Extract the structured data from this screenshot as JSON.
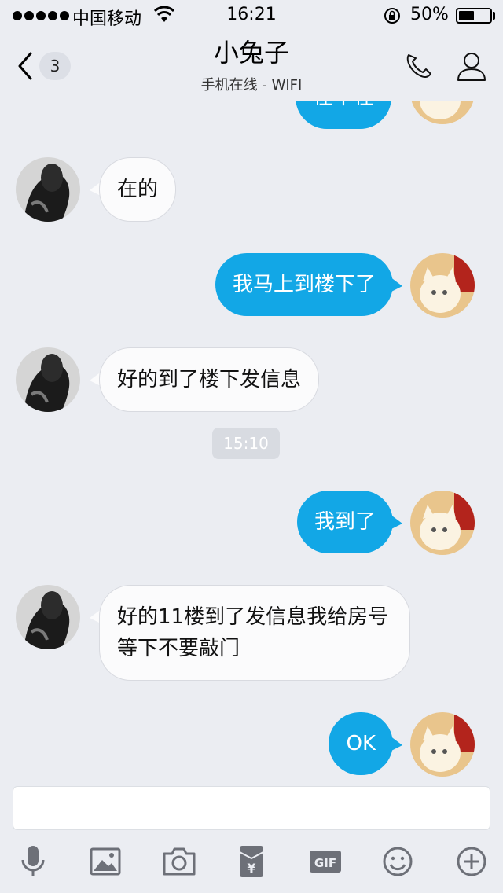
{
  "status_bar": {
    "carrier": "中国移动",
    "time": "16:21",
    "battery_percent": "50%",
    "battery_level": 0.5
  },
  "nav": {
    "back_badge": "3",
    "title": "小兔子",
    "subtitle": "手机在线 - WIFI"
  },
  "chat": {
    "partial_top_text": "在不在",
    "messages": [
      {
        "sender": "contact",
        "text": "在的"
      },
      {
        "sender": "me",
        "text": "我马上到楼下了"
      },
      {
        "sender": "contact",
        "text": "好的到了楼下发信息"
      },
      {
        "type": "time",
        "text": "15:10"
      },
      {
        "sender": "me",
        "text": "我到了"
      },
      {
        "sender": "contact",
        "text": "好的11楼到了发信息我给房号等下不要敲门"
      },
      {
        "sender": "me",
        "text": "OK"
      }
    ]
  },
  "input": {
    "value": "",
    "placeholder": ""
  },
  "toolbar": {
    "items": [
      "mic-icon",
      "image-icon",
      "camera-icon",
      "red-packet-icon",
      "gif-icon",
      "emoji-icon",
      "plus-icon"
    ],
    "gif_label": "GIF",
    "yen_label": "¥"
  },
  "colors": {
    "outgoing_bubble": "#12a7e6",
    "incoming_bubble": "#fbfbfc",
    "background": "#ebedf2"
  }
}
